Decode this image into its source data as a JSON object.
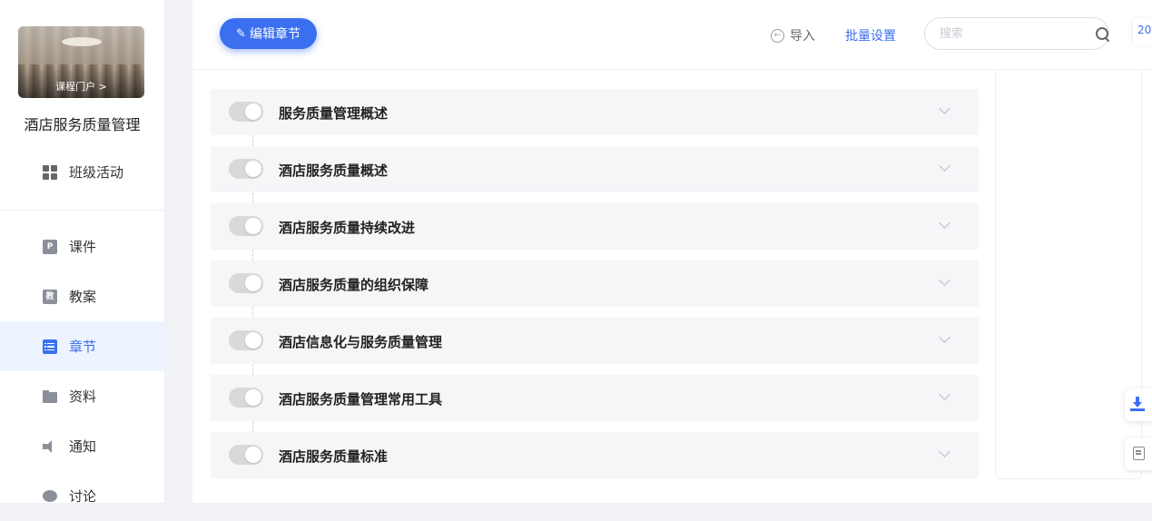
{
  "sidebar": {
    "cover_label": "课程门户 >",
    "course_name": "酒店服务质量管理",
    "items": [
      {
        "label": "班级活动",
        "icon": "grid-icon",
        "active": false
      },
      {
        "label": "课件",
        "icon": "ppt-icon",
        "active": false
      },
      {
        "label": "教案",
        "icon": "lesson-plan-icon",
        "active": false
      },
      {
        "label": "章节",
        "icon": "chapter-list-icon",
        "active": true
      },
      {
        "label": "资料",
        "icon": "folder-icon",
        "active": false
      },
      {
        "label": "通知",
        "icon": "speaker-icon",
        "active": false
      },
      {
        "label": "讨论",
        "icon": "chat-bubble-icon",
        "active": false
      }
    ]
  },
  "toolbar": {
    "edit_label": "编辑章节",
    "import_label": "导入",
    "batch_label": "批量设置",
    "search_placeholder": "搜索",
    "right_tab_text": "20"
  },
  "chapters": [
    {
      "title": "服务质量管理概述",
      "enabled": false
    },
    {
      "title": "酒店服务质量概述",
      "enabled": false
    },
    {
      "title": "酒店服务质量持续改进",
      "enabled": false
    },
    {
      "title": "酒店服务质量的组织保障",
      "enabled": false
    },
    {
      "title": "酒店信息化与服务质量管理",
      "enabled": false
    },
    {
      "title": "酒店服务质量管理常用工具",
      "enabled": false
    },
    {
      "title": "酒店服务质量标准",
      "enabled": false
    }
  ],
  "colors": {
    "accent": "#3a6ff0",
    "row_bg": "#f5f6f8",
    "toggle_off": "#d9d9d9"
  }
}
